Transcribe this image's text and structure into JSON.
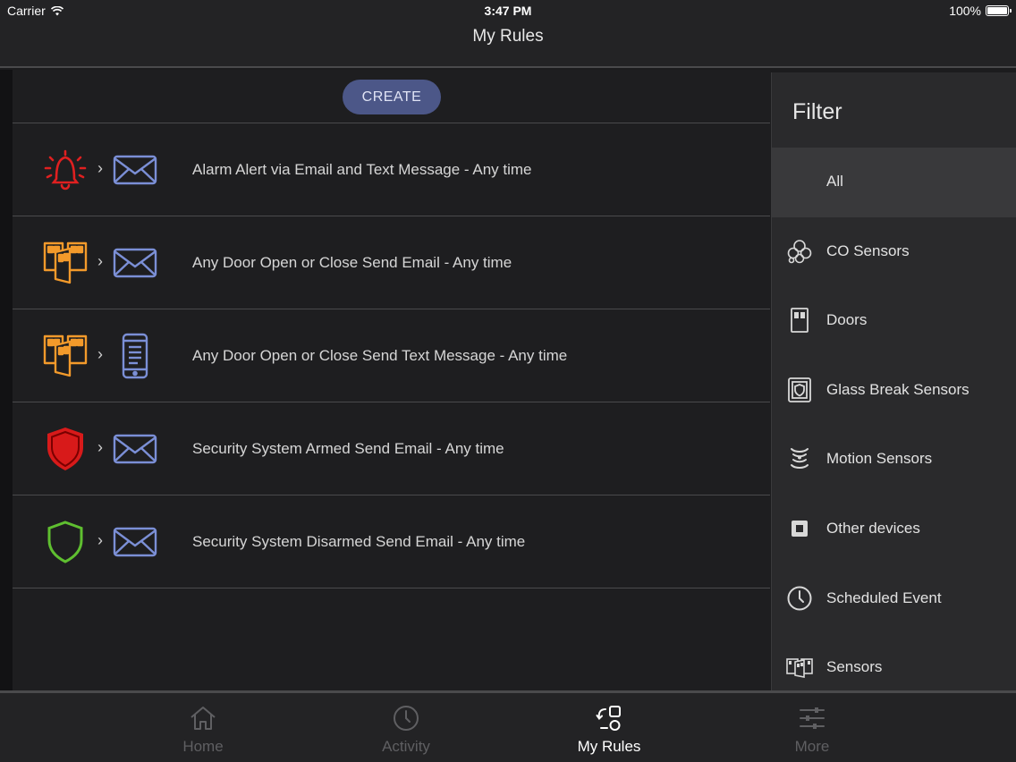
{
  "status_bar": {
    "carrier": "Carrier",
    "time": "3:47 PM",
    "battery": "100%"
  },
  "nav": {
    "title": "My Rules"
  },
  "create_label": "CREATE",
  "rules": [
    {
      "label": "Alarm Alert via Email and Text Message - Any time",
      "trigger_icon": "alarm-bell-icon",
      "action_icon": "envelope-icon"
    },
    {
      "label": "Any Door Open or Close Send Email - Any time",
      "trigger_icon": "doors-icon",
      "action_icon": "envelope-icon"
    },
    {
      "label": "Any Door Open or Close Send Text Message - Any time",
      "trigger_icon": "doors-icon",
      "action_icon": "phone-icon"
    },
    {
      "label": "Security System Armed Send Email - Any time",
      "trigger_icon": "shield-armed-icon",
      "action_icon": "envelope-icon"
    },
    {
      "label": "Security System Disarmed Send Email - Any time",
      "trigger_icon": "shield-disarmed-icon",
      "action_icon": "envelope-icon"
    }
  ],
  "filter": {
    "title": "Filter",
    "items": [
      {
        "label": "All",
        "selected": true
      },
      {
        "label": "CO Sensors",
        "icon": "co-sensor-icon"
      },
      {
        "label": "Doors",
        "icon": "door-icon"
      },
      {
        "label": "Glass Break Sensors",
        "icon": "glass-break-icon"
      },
      {
        "label": "Motion Sensors",
        "icon": "motion-sensor-icon"
      },
      {
        "label": "Other devices",
        "icon": "other-device-icon"
      },
      {
        "label": "Scheduled Event",
        "icon": "clock-icon"
      },
      {
        "label": "Sensors",
        "icon": "sensors-icon"
      }
    ]
  },
  "tabs": [
    {
      "label": "Home",
      "icon": "home-icon",
      "active": false
    },
    {
      "label": "Activity",
      "icon": "clock-icon",
      "active": false
    },
    {
      "label": "My Rules",
      "icon": "rules-icon",
      "active": true
    },
    {
      "label": "More",
      "icon": "sliders-icon",
      "active": false
    }
  ],
  "colors": {
    "accent_button": "#4c5788",
    "alarm_red": "#e02020",
    "door_orange": "#f39a2b",
    "action_blue": "#7b8fd6",
    "disarmed_green": "#5fbf30"
  }
}
